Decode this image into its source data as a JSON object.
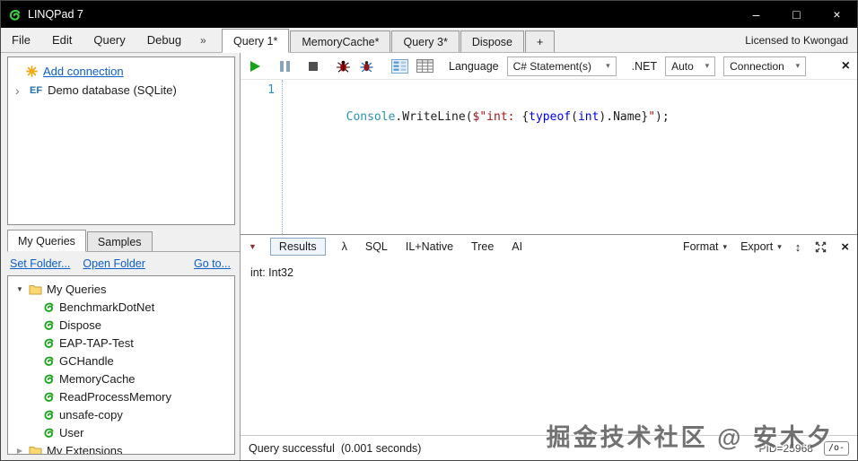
{
  "titlebar": {
    "title": "LINQPad 7",
    "minimize": "–",
    "maximize": "□",
    "close": "×"
  },
  "menu": {
    "items": [
      "File",
      "Edit",
      "Query",
      "Debug"
    ],
    "overflow": "»",
    "license": "Licensed to Kwongad"
  },
  "query_tabs": [
    {
      "label": "Query 1*",
      "active": true
    },
    {
      "label": "MemoryCache*"
    },
    {
      "label": "Query 3*"
    },
    {
      "label": "Dispose"
    },
    {
      "label": "+"
    }
  ],
  "connections": {
    "add_label": "Add connection",
    "item_chevron": "›",
    "item_prefix": "EF",
    "item_label": "Demo database (SQLite)"
  },
  "left_tabs": [
    {
      "label": "My Queries",
      "active": true
    },
    {
      "label": "Samples"
    }
  ],
  "queries_panel": {
    "set_folder": "Set Folder...",
    "open_folder": "Open Folder",
    "go_to": "Go to...",
    "root_arrow": "▼",
    "root_label": "My Queries",
    "items": [
      "BenchmarkDotNet",
      "Dispose",
      "EAP-TAP-Test",
      "GCHandle",
      "MemoryCache",
      "ReadProcessMemory",
      "unsafe-copy",
      "User"
    ],
    "extensions_arrow": "▶",
    "extensions_label": "My Extensions"
  },
  "toolbar": {
    "language_label": "Language",
    "language_value": "C# Statement(s)",
    "dotnet_label": ".NET",
    "dotnet_value": "Auto",
    "connection_value": "Connection",
    "dropdown_arrow": "▾",
    "close": "×"
  },
  "editor": {
    "line_number": "1",
    "code": [
      {
        "text": "Console",
        "color": "#2B91AF"
      },
      {
        "text": ".WriteLine(",
        "color": "#1B1B1B"
      },
      {
        "text": "$\"int: ",
        "color": "#A31515"
      },
      {
        "text": "{",
        "color": "#1B1B1B"
      },
      {
        "text": "typeof",
        "color": "#0000E6"
      },
      {
        "text": "(",
        "color": "#1B1B1B"
      },
      {
        "text": "int",
        "color": "#0000E6"
      },
      {
        "text": ")",
        "color": "#1B1B1B"
      },
      {
        "text": ".Name",
        "color": "#1B1B1B"
      },
      {
        "text": "}",
        "color": "#1B1B1B"
      },
      {
        "text": "\"",
        "color": "#A31515"
      },
      {
        "text": ");",
        "color": "#1B1B1B"
      }
    ]
  },
  "results": {
    "collapse_arrow": "▼",
    "tabs": [
      {
        "label": "Results",
        "active": true
      },
      {
        "label": "λ"
      },
      {
        "label": "SQL"
      },
      {
        "label": "IL+Native"
      },
      {
        "label": "Tree"
      },
      {
        "label": "AI"
      }
    ],
    "format_label": "Format",
    "export_label": "Export",
    "dropdown_arrow": "▾",
    "updown_icon": "↕",
    "close": "×",
    "output": "int: Int32"
  },
  "statusbar": {
    "message": "Query successful  (0.001 seconds)",
    "pid": "PID=25968",
    "corner": "/o-"
  },
  "watermark": "掘金技术社区 @ 安木夕",
  "colors": {
    "link_blue": "#0B5FCC",
    "play_green": "#17A317",
    "bug_red": "#A40000",
    "keyword_blue": "#0000E6",
    "type_teal": "#2B91AF",
    "string_maroon": "#A31515",
    "folder_yellow": "#FDD870",
    "query_icon_green": "#17A317"
  }
}
